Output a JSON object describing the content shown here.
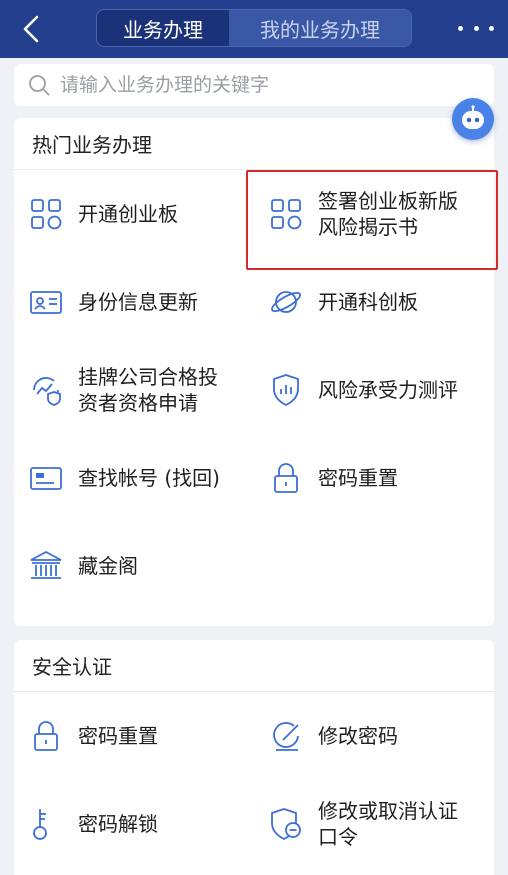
{
  "header": {
    "tabs": [
      {
        "label": "业务办理",
        "active": true
      },
      {
        "label": "我的业务办理",
        "active": false
      }
    ]
  },
  "search": {
    "placeholder": "请输入业务办理的关键字"
  },
  "hot": {
    "title": "热门业务办理",
    "items": [
      {
        "label": "开通创业板",
        "icon": "grid-apps-icon"
      },
      {
        "label": "签署创业板新版\n风险揭示书",
        "icon": "grid-apps-icon"
      },
      {
        "label": "身份信息更新",
        "icon": "id-card-icon"
      },
      {
        "label": "开通科创板",
        "icon": "planet-icon"
      },
      {
        "label": "挂牌公司合格投\n资者资格申请",
        "icon": "chart-shield-icon"
      },
      {
        "label": "风险承受力测评",
        "icon": "shield-chart-icon"
      },
      {
        "label": "查找帐号 (找回)",
        "icon": "card-icon"
      },
      {
        "label": "密码重置",
        "icon": "lock-icon"
      },
      {
        "label": "藏金阁",
        "icon": "building-icon"
      }
    ]
  },
  "security": {
    "title": "安全认证",
    "items": [
      {
        "label": "密码重置",
        "icon": "lock-icon"
      },
      {
        "label": "修改密码",
        "icon": "edit-icon"
      },
      {
        "label": "密码解锁",
        "icon": "key-icon"
      },
      {
        "label": "修改或取消认证\n口令",
        "icon": "shield-minus-icon"
      }
    ]
  },
  "colors": {
    "header_bg": "#243f8e",
    "accent": "#3c6fd6",
    "highlight": "#d42a2a"
  }
}
